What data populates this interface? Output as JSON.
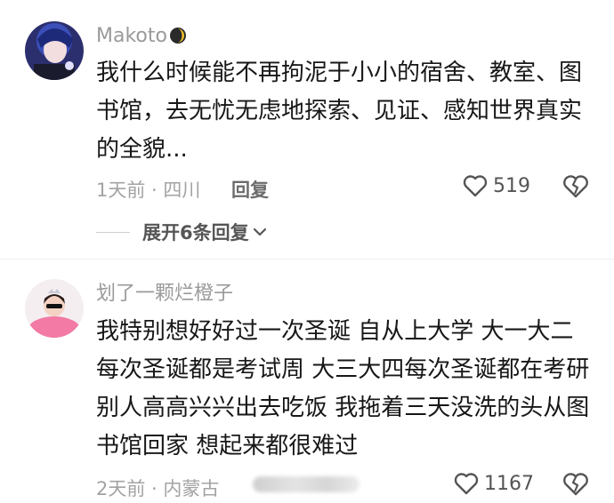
{
  "comments": [
    {
      "username": "Makoto",
      "text_lines": [
        "我什么时候能不再拘泥于小小的宿舍、教室、图",
        "书馆，去无忧无虑地探索、见证、感知世界真实",
        "的全貌..."
      ],
      "meta": "1天前 · 四川",
      "reply_label": "回复",
      "likes": "519",
      "expand_label": "展开6条回复"
    },
    {
      "username": "划了一颗烂橙子",
      "text_lines": [
        "我特别想好好过一次圣诞 自从上大学 大一大二",
        "每次圣诞都是考试周 大三大四每次圣诞都在考研",
        "别人高高兴兴出去吃饭 我拖着三天没洗的头从图",
        "书馆回家 想起来都很难过"
      ],
      "meta": "2天前 · 内蒙古",
      "likes": "1167"
    }
  ],
  "icons": {
    "like": "heart-outline-icon",
    "dislike": "broken-heart-icon",
    "expand": "chevron-down-icon",
    "username_badge": "moon-icon"
  }
}
